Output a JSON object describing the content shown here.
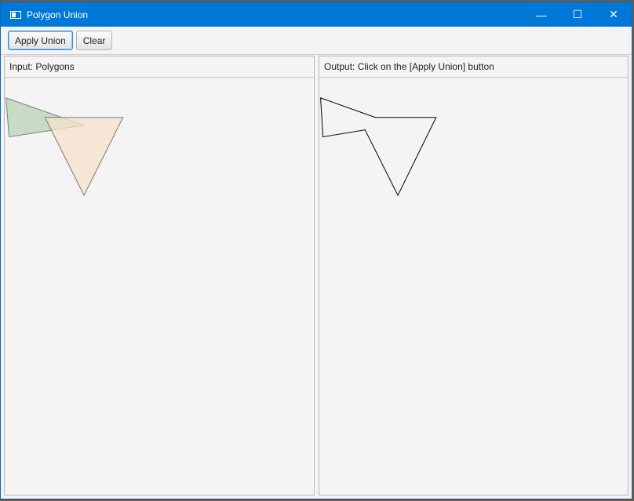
{
  "window": {
    "title": "Polygon Union",
    "controls": {
      "minimize": "—",
      "maximize": "☐",
      "close": "✕"
    }
  },
  "toolbar": {
    "apply_label": "Apply Union",
    "clear_label": "Clear"
  },
  "input_pane": {
    "header": "Input: Polygons",
    "polygons": [
      {
        "fill": "#b9d3b4",
        "stroke": "#7c7c7c",
        "opacity": 0.75
      },
      {
        "fill": "#f8e1cc",
        "stroke": "#7c7c7c",
        "opacity": 0.75
      }
    ]
  },
  "output_pane": {
    "header": "Output: Click on the [Apply Union] button",
    "stroke": "#000000"
  }
}
